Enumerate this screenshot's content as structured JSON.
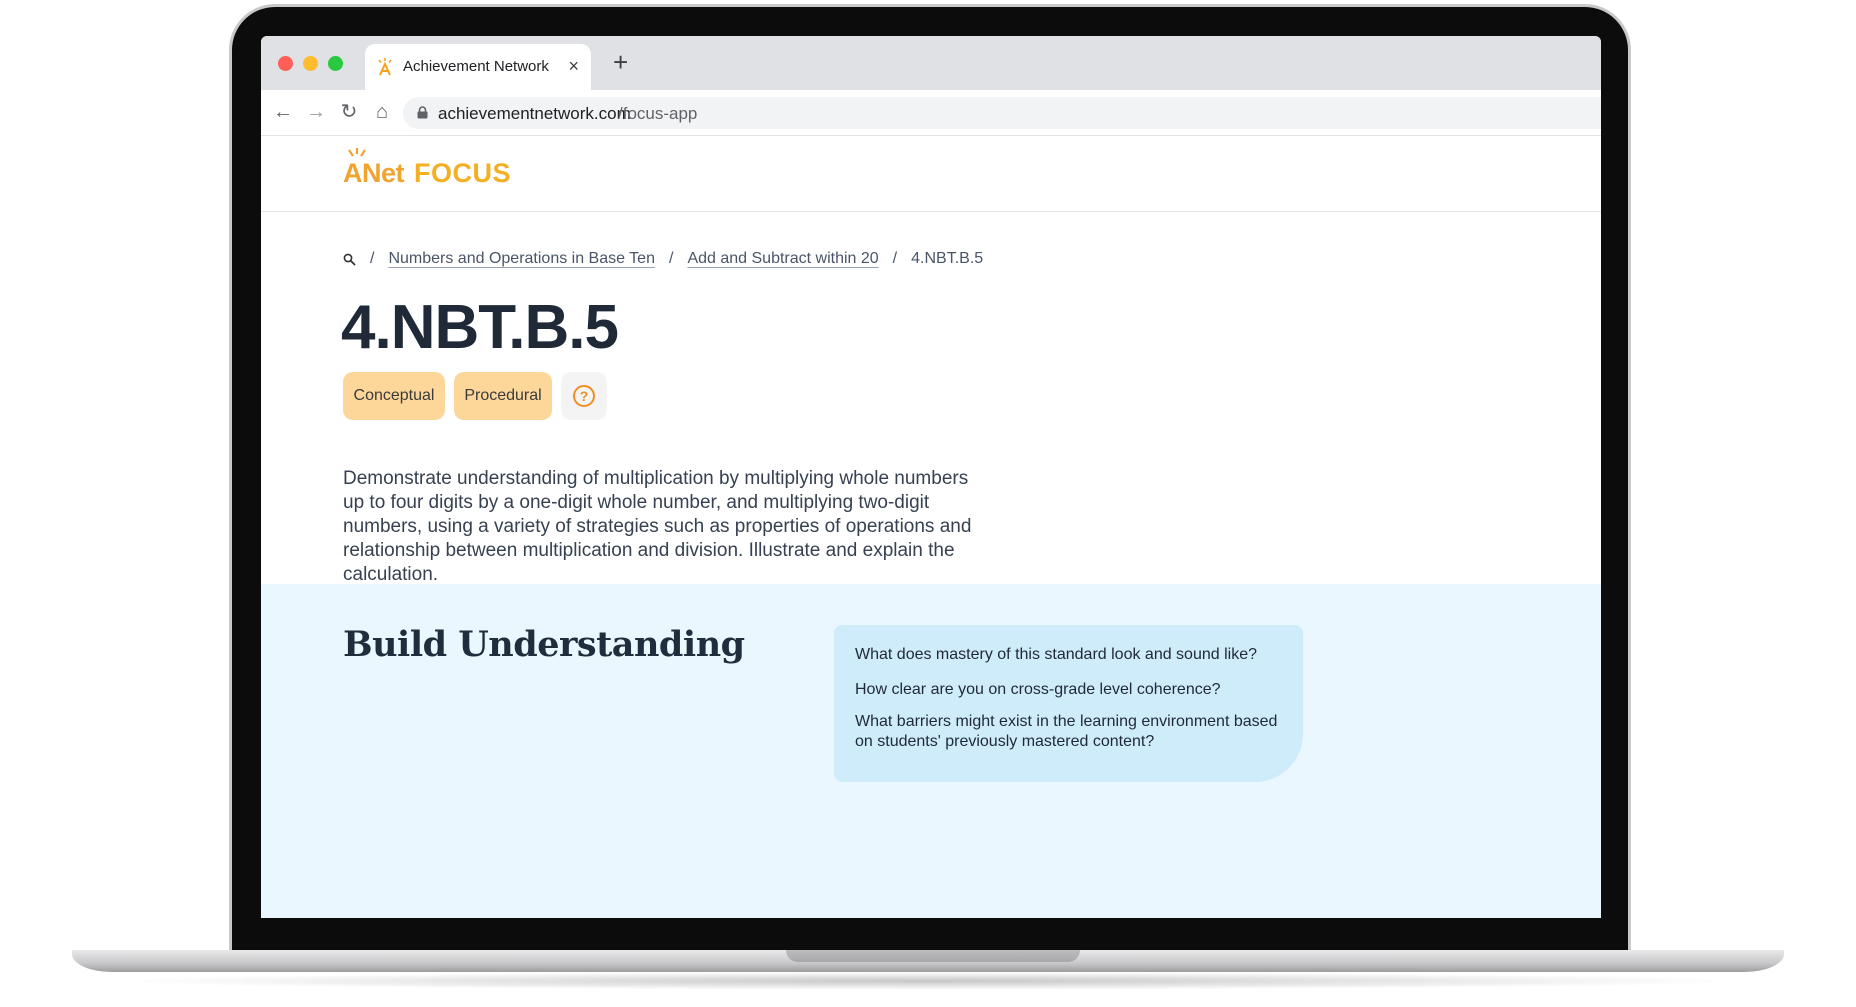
{
  "browser": {
    "tab_title": "Achievement Network",
    "tab_close": "×",
    "new_tab": "+",
    "url_host": "achievementnetwork.com",
    "url_path": "/focus-app",
    "nav": {
      "back": "←",
      "forward": "→",
      "reload": "↻",
      "home": "⌂"
    }
  },
  "header": {
    "logo_anet": "ANet",
    "logo_focus": "FOCUS"
  },
  "breadcrumb": {
    "items": [
      {
        "label": "Numbers and Operations in Base Ten"
      },
      {
        "label": "Add and Subtract within 20"
      },
      {
        "label": "4.NBT.B.5"
      }
    ],
    "separator": "/"
  },
  "standard": {
    "code": "4.NBT.B.5",
    "tags": [
      "Conceptual",
      "Procedural"
    ],
    "help_symbol": "?",
    "description": "Demonstrate understanding of multiplication by multiplying whole numbers up to four digits by a one-digit whole number, and multiplying two-digit numbers, using a variety of strategies such as properties of operations and relationship between multiplication and division. Illustrate and explain the calculation."
  },
  "build_understanding": {
    "title": "Build Understanding",
    "questions": [
      "What does mastery of this standard look and sound like?",
      "How clear are you on cross-grade level coherence?",
      "What barriers might exist in the learning environment based on students' previously mastered content?"
    ]
  },
  "colors": {
    "chip_bg": "#fdd699",
    "help_accent": "#ee8f25",
    "logo_orange": "#f0a430",
    "section_bg": "#ebf7fe",
    "card_bg": "#cfecfb"
  },
  "icons": {
    "tab_favicon": "anet-sun-icon",
    "lock": "lock-icon",
    "breadcrumb_search": "search-icon",
    "help": "question-circle-icon"
  }
}
